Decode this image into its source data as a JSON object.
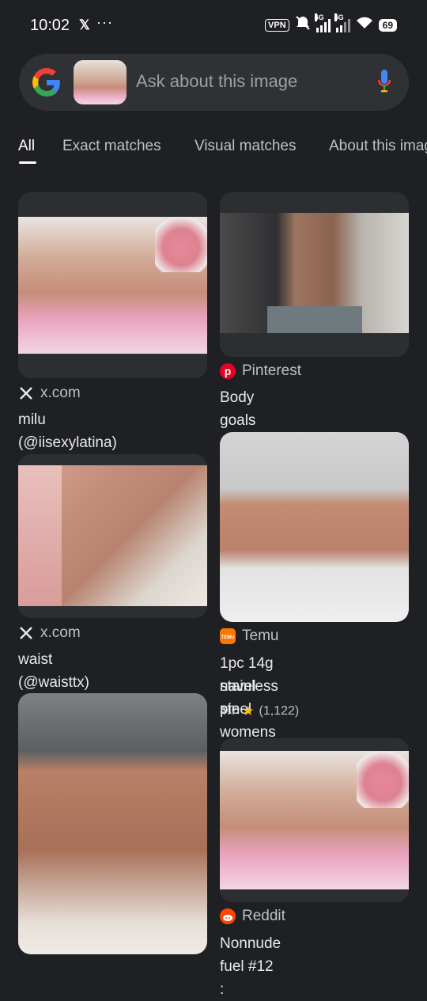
{
  "status_bar": {
    "time": "10:02",
    "x_glyph": "𝕏",
    "more": "···",
    "vpn": "VPN",
    "net1": "4G",
    "net2": "4G",
    "battery": "69"
  },
  "search": {
    "placeholder": "Ask about this image",
    "icons": [
      "google-logo",
      "mic-icon"
    ]
  },
  "tabs": [
    "All",
    "Exact matches",
    "Visual matches",
    "About this image"
  ],
  "results": [
    {
      "source": "x.com",
      "title": "milu (@iisexylatina) on X",
      "source_icon": "x-logo-icon"
    },
    {
      "source": "Pinterest",
      "title": "Body goals skinny",
      "source_icon": "pinterest-icon",
      "brand_color": "#e60023"
    },
    {
      "source": "x.com",
      "title": "waist (@waisttx) on X",
      "source_icon": "x-logo-icon"
    },
    {
      "source": "Temu",
      "title_line1": "1pc 14g stainless steel",
      "title_line2": "navel pin womens navel...",
      "rating": "4.7",
      "reviews": "(1,122)",
      "source_icon": "temu-icon",
      "brand_color": "#fb7701"
    },
    {
      "source": "x.com",
      "title": "",
      "source_icon": "x-logo-icon"
    },
    {
      "source": "Reddit",
      "title": "Nonnude fuel #12 :",
      "source_icon": "reddit-icon",
      "brand_color": "#ff4500"
    }
  ]
}
